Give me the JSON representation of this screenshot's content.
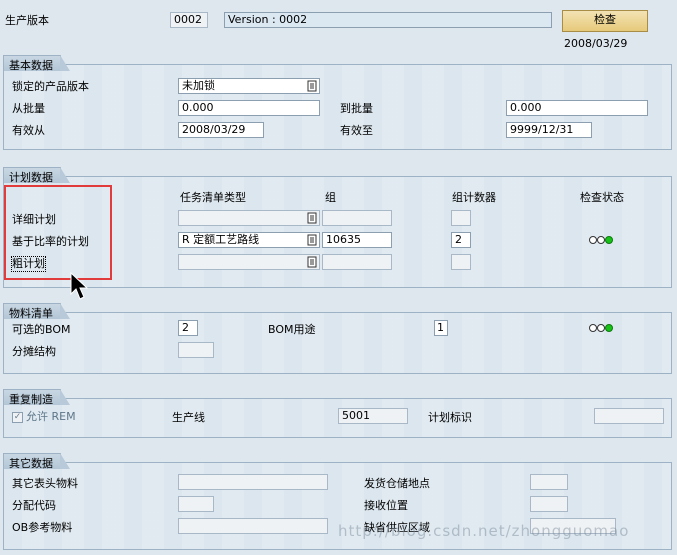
{
  "header": {
    "version_label": "生产版本",
    "version_value": "0002",
    "version_text": "Version : 0002",
    "check_button": "检查",
    "date": "2008/03/29"
  },
  "basic": {
    "title": "基本数据",
    "locked_label": "锁定的产品版本",
    "locked_value": "未加锁",
    "from_lot_label": "从批量",
    "from_lot_value": "0.000",
    "to_lot_label": "到批量",
    "to_lot_value": "0.000",
    "valid_from_label": "有效从",
    "valid_from_value": "2008/03/29",
    "valid_to_label": "有效至",
    "valid_to_value": "9999/12/31"
  },
  "plan": {
    "title": "计划数据",
    "col_type": "任务清单类型",
    "col_group": "组",
    "col_counter": "组计数器",
    "col_status": "检查状态",
    "rows": [
      {
        "label": "详细计划",
        "type": "",
        "group": "",
        "counter": ""
      },
      {
        "label": "基于比率的计划",
        "type": "R 定额工艺路线",
        "group": "10635",
        "counter": "2"
      },
      {
        "label": "粗计划",
        "type": "",
        "group": "",
        "counter": ""
      }
    ]
  },
  "bom": {
    "title": "物料清单",
    "alt_bom_label": "可选的BOM",
    "alt_bom_value": "2",
    "usage_label": "BOM用途",
    "usage_value": "1",
    "apportion_label": "分摊结构",
    "apportion_value": ""
  },
  "rem": {
    "title": "重复制造",
    "allow_label": "允许 REM",
    "line_label": "生产线",
    "line_value": "5001",
    "plan_id_label": "计划标识",
    "plan_id_value": ""
  },
  "other": {
    "title": "其它数据",
    "other_header_label": "其它表头物料",
    "issue_loc_label": "发货仓储地点",
    "dist_key_label": "分配代码",
    "receive_loc_label": "接收位置",
    "ob_ref_label": "OB参考物料",
    "default_supply_label": "缺省供应区域"
  },
  "watermark": "http://blog.csdn.net/zhongguomao",
  "colors": {
    "status_green": "#19c219",
    "highlight": "#e23b3b",
    "button": "#e6c97a"
  }
}
